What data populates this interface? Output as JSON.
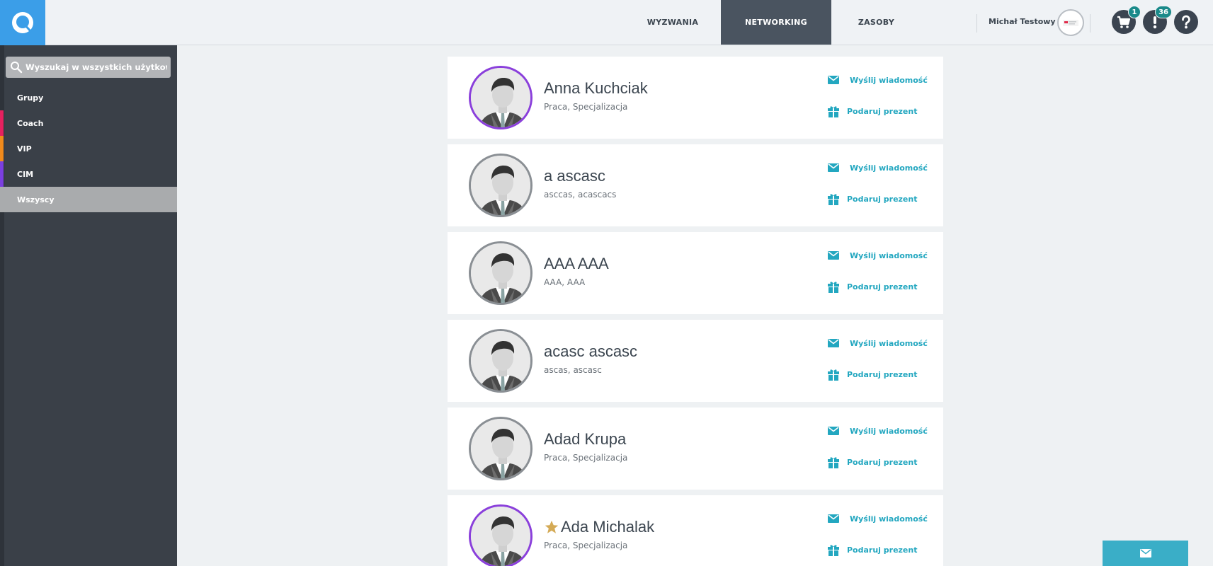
{
  "nav": {
    "items": [
      {
        "label": "WYZWANIA"
      },
      {
        "label": "NETWORKING",
        "active": true
      },
      {
        "label": "ZASOBY"
      }
    ],
    "user_name": "Michał Testowy",
    "cart_badge": "1",
    "notifications_badge": "36"
  },
  "sidebar": {
    "search_placeholder": "Wyszukaj w wszystkich użytkownikach",
    "items": [
      {
        "label": "Grupy",
        "accent": ""
      },
      {
        "label": "Coach",
        "accent": "#e6215f"
      },
      {
        "label": "VIP",
        "accent": "#f08a1c"
      },
      {
        "label": "CIM",
        "accent": "#7b3fe0"
      },
      {
        "label": "Wszyscy",
        "accent": "",
        "active": true
      }
    ]
  },
  "actions": {
    "send_message": "Wyślij wiadomość",
    "give_gift": "Podaruj prezent"
  },
  "users": [
    {
      "name": "Anna Kuchciak",
      "subtitle": "Praca, Specjalizacja",
      "ring": "purple",
      "star": false
    },
    {
      "name": "a ascasc",
      "subtitle": "asccas, acascacs",
      "ring": "gray",
      "star": false
    },
    {
      "name": "AAA AAA",
      "subtitle": "AAA, AAA",
      "ring": "gray",
      "star": false
    },
    {
      "name": "acasc ascasc",
      "subtitle": "ascas, ascasc",
      "ring": "gray",
      "star": false
    },
    {
      "name": "Adad Krupa",
      "subtitle": "Praca, Specjalizacja",
      "ring": "gray",
      "star": false
    },
    {
      "name": "Ada Michalak",
      "subtitle": "Praca, Specjalizacja",
      "ring": "purple",
      "star": true
    }
  ],
  "colors": {
    "accent_blue": "#3b9ee8",
    "link_teal": "#23a7c0",
    "purple_ring": "#8a3fdb",
    "star_gold": "#d4aa55"
  }
}
